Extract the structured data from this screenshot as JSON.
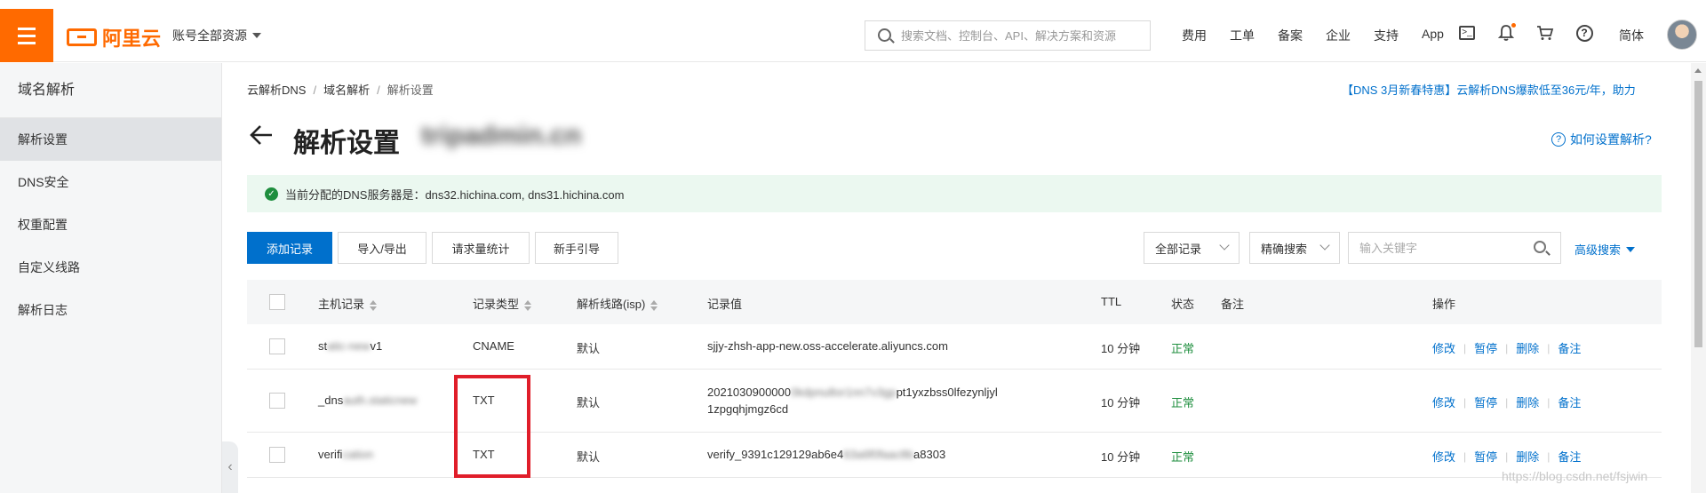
{
  "topbar": {
    "logo_text": "阿里云",
    "account_label": "账号全部资源",
    "search_placeholder": "搜索文档、控制台、API、解决方案和资源",
    "links": [
      "费用",
      "工单",
      "备案",
      "企业",
      "支持",
      "App"
    ],
    "lang": "简体",
    "icons": [
      "terminal-icon",
      "bell-icon",
      "cart-icon",
      "help-icon"
    ]
  },
  "sidebar": {
    "title": "域名解析",
    "items": [
      {
        "label": "解析设置",
        "active": true
      },
      {
        "label": "DNS安全"
      },
      {
        "label": "权重配置"
      },
      {
        "label": "自定义线路"
      },
      {
        "label": "解析日志"
      }
    ]
  },
  "breadcrumb": [
    "云解析DNS",
    "域名解析",
    "解析设置"
  ],
  "promo": "【DNS 3月新春特惠】云解析DNS爆款低至36元/年，助力",
  "page": {
    "title": "解析设置",
    "domain": "tripadmin.cn",
    "help_link": "如何设置解析?"
  },
  "dns_info": {
    "label": "当前分配的DNS服务器是：",
    "servers": "dns32.hichina.com, dns31.hichina.com"
  },
  "toolbar": {
    "add": "添加记录",
    "import_export": "导入/导出",
    "stats": "请求量统计",
    "guide": "新手引导",
    "filter_all": "全部记录",
    "search_mode": "精确搜索",
    "keyword_placeholder": "输入关键字",
    "advanced": "高级搜索"
  },
  "table": {
    "headers": {
      "host": "主机记录",
      "type": "记录类型",
      "line": "解析线路(isp)",
      "value": "记录值",
      "ttl": "TTL",
      "status": "状态",
      "remark": "备注",
      "ops": "操作"
    },
    "rows": [
      {
        "host_prefix": "st",
        "host_hidden": "atic-new",
        "host_suffix": "v1",
        "type": "CNAME",
        "line": "默认",
        "value_lines": [
          "sjjy-zhsh-app-new.oss-accelerate.aliyuncs.com"
        ],
        "ttl": "10 分钟",
        "status": "正常"
      },
      {
        "host_prefix": "_dns",
        "host_hidden": "auth.staticnew",
        "host_suffix": "",
        "type": "TXT",
        "line": "默认",
        "value_lines": [
          "2021030900000",
          "0kdpnu8or1nn7v3gp",
          "pt1yxzbss0lfezynljyl",
          "1zpgqhjmgz6cd"
        ],
        "ttl": "10 分钟",
        "status": "正常"
      },
      {
        "host_prefix": "verifi",
        "host_hidden": "cation",
        "host_suffix": "",
        "type": "TXT",
        "line": "默认",
        "value_lines": [
          "verify_9391c129129ab6e4",
          "63a6f0faac8b",
          "a8303"
        ],
        "ttl": "10 分钟",
        "status": "正常"
      }
    ],
    "op_labels": [
      "修改",
      "暂停",
      "删除",
      "备注"
    ]
  },
  "watermark": "https://blog.csdn.net/fsjwin",
  "colors": {
    "brand": "#ff6a00",
    "primary": "#0070cc",
    "success": "#1e8e3e",
    "highlight": "#e01e2a"
  }
}
